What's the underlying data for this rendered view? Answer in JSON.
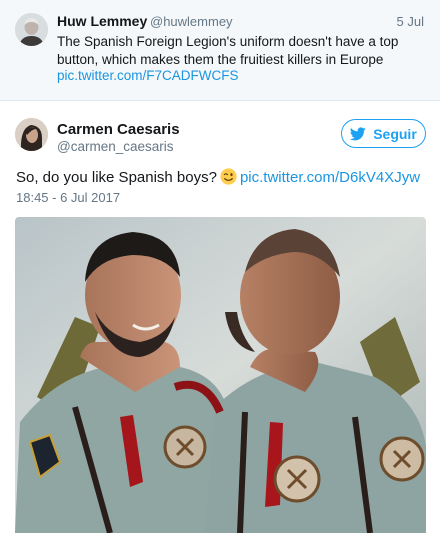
{
  "quoted_tweet": {
    "name": "Huw Lemmey",
    "handle": "@huwlemmey",
    "date": "5 Jul",
    "text": "The Spanish Foreign Legion's uniform doesn't have a top button, which makes them the fruitiest killers in Europe",
    "link": "pic.twitter.com/F7CADFWCFS"
  },
  "tweet": {
    "name": "Carmen Caesaris",
    "handle": "@carmen_caesaris",
    "follow_label": "Seguir",
    "text": "So, do you like Spanish boys?",
    "emoji": "winking-face-emoji",
    "link": "pic.twitter.com/D6kV4XJyw",
    "timestamp": "18:45 - 6 Jul 2017"
  },
  "icons": {
    "follow": "twitter-bird-icon",
    "emoji": "winking-face-emoji"
  },
  "colors": {
    "link": "#1b95e0",
    "accent": "#1da1f2",
    "quoted_bg": "#f5f8fa",
    "muted": "#657786"
  }
}
